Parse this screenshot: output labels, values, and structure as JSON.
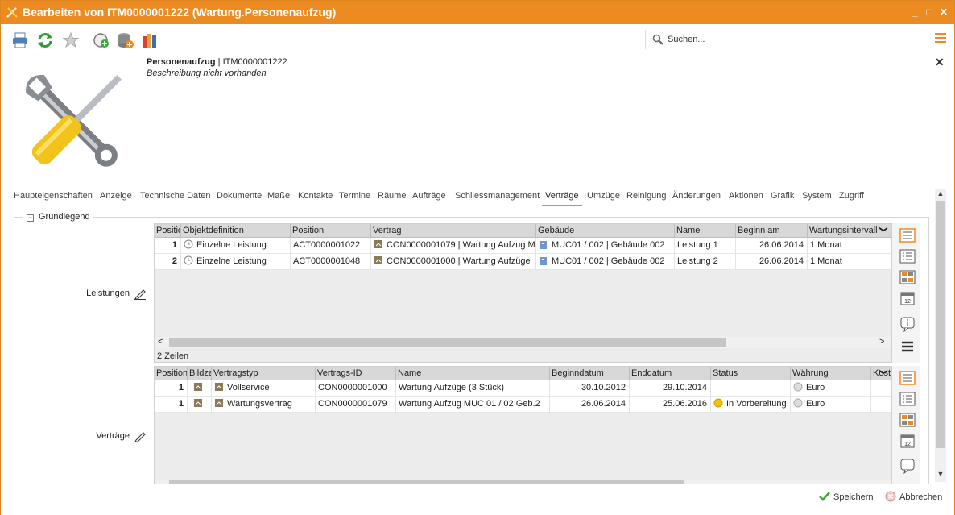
{
  "window": {
    "title": "Bearbeiten von ITM0000001222 (Wartung.Personenaufzug)",
    "minimize": "_",
    "maximize": "□",
    "close": "✕"
  },
  "toolbar": {
    "icons": [
      "print-icon",
      "refresh-icon",
      "favorite-star-icon",
      "add-view-icon",
      "database-add-icon",
      "books-icon"
    ],
    "search_label": "Suchen..."
  },
  "header": {
    "object_type": "Personenaufzug",
    "separator": "|",
    "object_id": "ITM0000001222",
    "description": "Beschreibung nicht vorhanden",
    "close": "✕"
  },
  "tabs": [
    {
      "label": "Haupteigenschaften"
    },
    {
      "label": "Anzeige"
    },
    {
      "label": "Technische Daten"
    },
    {
      "label": "Dokumente"
    },
    {
      "label": "Maße"
    },
    {
      "label": "Kontakte"
    },
    {
      "label": "Termine"
    },
    {
      "label": "Räume"
    },
    {
      "label": "Aufträge"
    },
    {
      "label": "Schliessmanagement"
    },
    {
      "label": "Verträge",
      "active": true
    },
    {
      "label": "Umzüge"
    },
    {
      "label": "Reinigung"
    },
    {
      "label": "Änderungen"
    },
    {
      "label": "Aktionen"
    },
    {
      "label": "Grafik"
    },
    {
      "label": "System"
    },
    {
      "label": "Zugriff"
    }
  ],
  "group": {
    "toggle": "−",
    "title": "Grundlegend"
  },
  "leistungen": {
    "label": "Leistungen",
    "columns": [
      "Positio",
      "Objektdefinition",
      "Position",
      "Vertrag",
      "Gebäude",
      "Name",
      "Beginn am",
      "Wartungsintervall"
    ],
    "rows": [
      [
        "1",
        "Einzelne Leistung",
        "ACT0000001022",
        "CON0000001079 | Wartung Aufzug M",
        "MUC01 / 002 | Gebäude 002",
        "Leistung 1",
        "26.06.2014",
        "1 Monat"
      ],
      [
        "2",
        "Einzelne Leistung",
        "ACT0000001048",
        "CON0000001000 | Wartung Aufzüge",
        "MUC01 / 002 | Gebäude 002",
        "Leistung 2",
        "26.06.2014",
        "1 Monat"
      ]
    ],
    "row_count": "2 Zeilen",
    "scroll_left": "<",
    "scroll_right": ">",
    "header_menu": "❯"
  },
  "vertraege": {
    "label": "Verträge",
    "columns": [
      "Position",
      "Bildze",
      "Vertragstyp",
      "Vertrags-ID",
      "Name",
      "Beginndatum",
      "Enddatum",
      "Status",
      "Währung",
      "Kost"
    ],
    "rows": [
      [
        "1",
        "",
        "Vollservice",
        "CON0000001000",
        "Wartung Aufzüge (3 Stück)",
        "30.10.2012",
        "29.10.2014",
        "",
        "Euro"
      ],
      [
        "1",
        "",
        "Wartungsvertrag",
        "CON0000001079",
        "Wartung Aufzug MUC 01 / 02 Geb.2",
        "26.06.2014",
        "25.06.2016",
        "In Vorbereitung",
        "Euro"
      ]
    ],
    "header_menu": "❯"
  },
  "sidebar_icons": [
    "list-view-icon",
    "detail-list-icon",
    "tile-view-icon",
    "calendar-icon",
    "info-icon",
    "menu-icon"
  ],
  "sidebar_icons_2": [
    "list-view-icon",
    "detail-list-icon",
    "tile-view-icon",
    "calendar-icon",
    "comment-icon"
  ],
  "scrollbar": {
    "up": "▲",
    "down": "▼"
  },
  "footer": {
    "save_label": "Speichern",
    "cancel_label": "Abbrechen"
  },
  "colors": {
    "accent": "#ec8b22",
    "grid_header": "#d8d8d8",
    "grid_bg": "#ececec"
  }
}
